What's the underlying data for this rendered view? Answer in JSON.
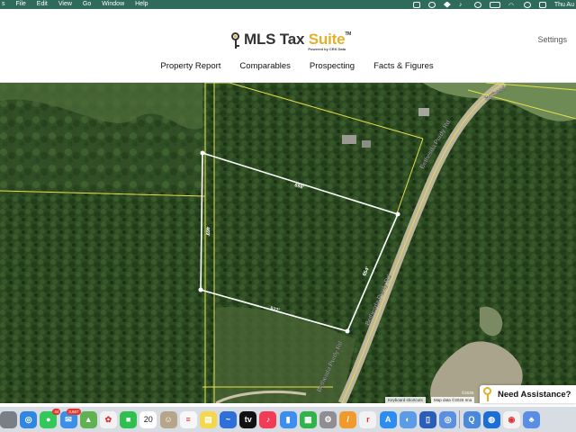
{
  "menubar": {
    "items": [
      "File",
      "Edit",
      "View",
      "Go",
      "Window",
      "Help"
    ],
    "date": "Thu Au"
  },
  "header": {
    "logo_main": "MLS Tax ",
    "logo_accent": "Suite",
    "logo_tm": "TM",
    "logo_powered": "Powered by CRS Data",
    "settings_label": "Settings",
    "nav": [
      "Property Report",
      "Comparables",
      "Prospecting",
      "Facts & Figures"
    ]
  },
  "map": {
    "measurements": {
      "north": "698'",
      "west": "469'",
      "south": "522'",
      "east": "654'"
    },
    "road_labels": [
      "Bethesda Purdy Rd",
      "Bethesda Purdy Rd",
      "Bethesda Purdy Rd",
      "Bethesd"
    ],
    "attribution_shortcuts": "Keyboard shortcuts",
    "attribution_data": "Map data ©2026 Ima",
    "attribution_extra": "©2026",
    "colors": {
      "forest": "#2c4a22",
      "parcel_line": "#e6e04a",
      "measure_line": "#ffffff",
      "road": "#c9c2a8"
    }
  },
  "assist": {
    "label": "Need Assistance?"
  },
  "dock": {
    "apps": [
      {
        "name": "launchpad",
        "color": "#7a7f87",
        "glyph": ""
      },
      {
        "name": "safari",
        "color": "#2f86e3",
        "glyph": "◎"
      },
      {
        "name": "messages",
        "color": "#34c759",
        "glyph": "●",
        "badge": "44"
      },
      {
        "name": "mail",
        "color": "#3b8fe8",
        "glyph": "✉",
        "badge": "3,667"
      },
      {
        "name": "maps",
        "color": "#5fb24f",
        "glyph": "▲"
      },
      {
        "name": "photos",
        "color": "#f2f2f2",
        "glyph": "✿"
      },
      {
        "name": "facetime",
        "color": "#2fbf4f",
        "glyph": "■"
      },
      {
        "name": "calendar",
        "color": "#ffffff",
        "glyph": "20"
      },
      {
        "name": "contacts",
        "color": "#b7a58a",
        "glyph": "☺"
      },
      {
        "name": "reminders",
        "color": "#f7f7f7",
        "glyph": "≡"
      },
      {
        "name": "notes",
        "color": "#f6d64a",
        "glyph": "▤"
      },
      {
        "name": "freeform",
        "color": "#2e6fd9",
        "glyph": "~"
      },
      {
        "name": "tv",
        "color": "#111111",
        "glyph": "tv"
      },
      {
        "name": "music",
        "color": "#f23c55",
        "glyph": "♪"
      },
      {
        "name": "keynote",
        "color": "#3d8ef0",
        "glyph": "▮"
      },
      {
        "name": "numbers",
        "color": "#2fb34a",
        "glyph": "▦"
      },
      {
        "name": "system-settings",
        "color": "#8e8e93",
        "glyph": "⚙"
      },
      {
        "name": "pages",
        "color": "#f09a2c",
        "glyph": "/"
      },
      {
        "name": "reeder",
        "color": "#f2f2f2",
        "glyph": "r"
      },
      {
        "name": "app-store",
        "color": "#2d8cf0",
        "glyph": "A"
      },
      {
        "name": "preview",
        "color": "#5a9de6",
        "glyph": "◐"
      },
      {
        "name": "word",
        "color": "#2b5eb8",
        "glyph": "▯"
      },
      {
        "name": "zoom",
        "color": "#5a8fe2",
        "glyph": "◎"
      },
      {
        "name": "finder-2",
        "color": "#4a88d9",
        "glyph": "Q"
      },
      {
        "name": "screen-sharing",
        "color": "#1b6fd4",
        "glyph": "◍"
      },
      {
        "name": "chrome",
        "color": "#f2f2f2",
        "glyph": "◉"
      },
      {
        "name": "trash",
        "color": "#5a8ee6",
        "glyph": "♣"
      }
    ]
  }
}
